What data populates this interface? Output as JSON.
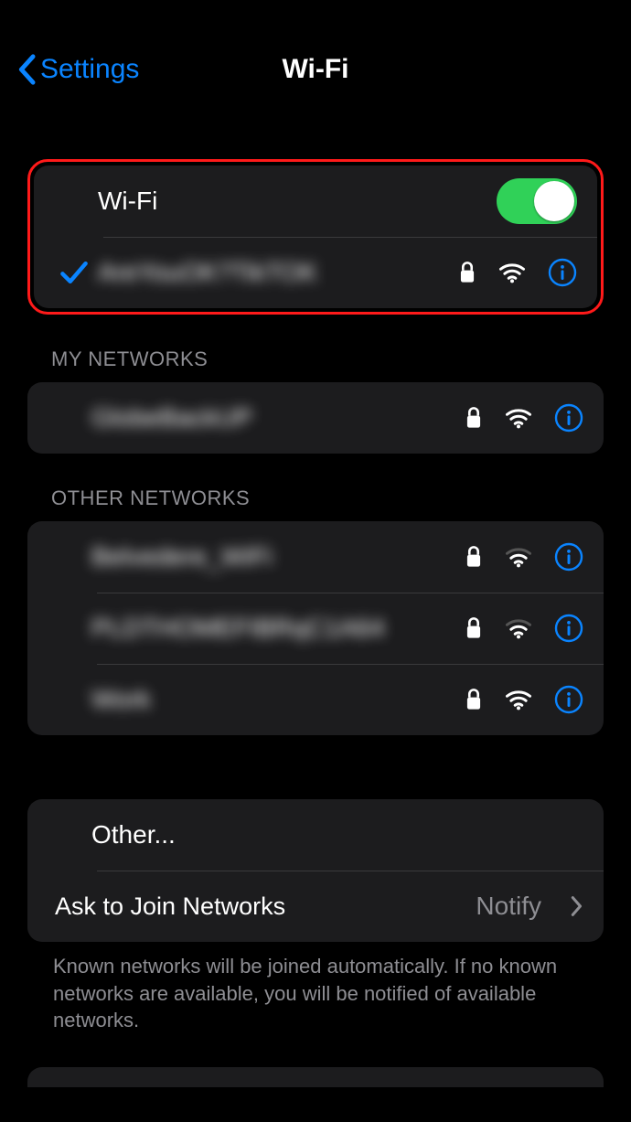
{
  "header": {
    "back_label": "Settings",
    "title": "Wi-Fi"
  },
  "wifi_group": {
    "wifi_label": "Wi-Fi",
    "wifi_enabled": true,
    "connected_network_name": "AreYouOK?TikTOK"
  },
  "sections": {
    "my_networks_header": "MY NETWORKS",
    "other_networks_header": "OTHER NETWORKS"
  },
  "my_networks": [
    {
      "name": "GlobeBackUP"
    }
  ],
  "other_networks": [
    {
      "name": "Belvedere_WiFi"
    },
    {
      "name": "PLDTHOMEFIBRqC1A64"
    },
    {
      "name": "Work"
    }
  ],
  "other_row": {
    "label": "Other..."
  },
  "ask_join": {
    "label": "Ask to Join Networks",
    "value": "Notify",
    "footer": "Known networks will be joined automatically. If no known networks are available, you will be notified of available networks."
  },
  "colors": {
    "accent_blue": "#0a84ff",
    "toggle_green": "#30d158",
    "highlight_red": "#ff1a1a"
  }
}
